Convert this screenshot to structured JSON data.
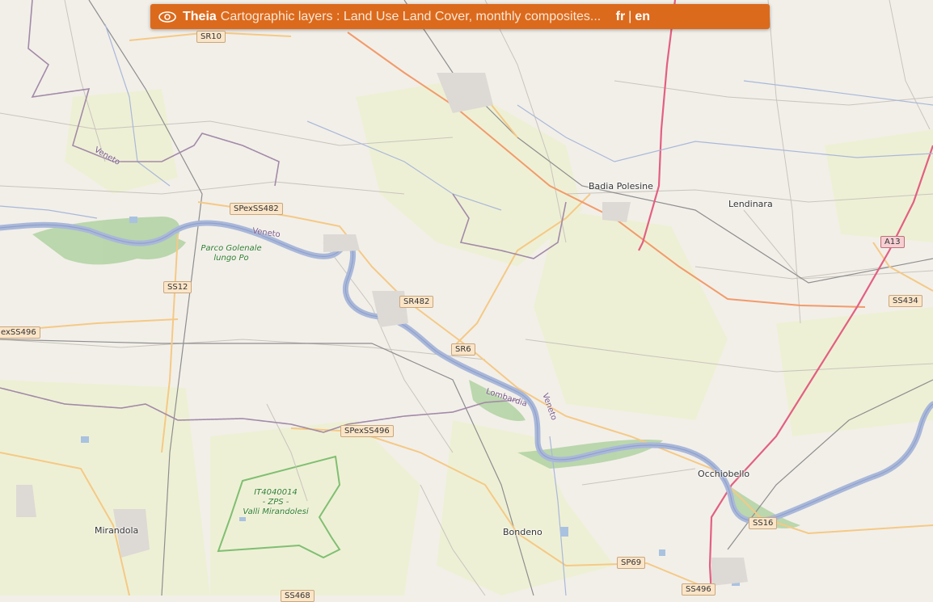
{
  "header": {
    "brand": "Theia",
    "description": "Cartographic layers : Land Use Land Cover, monthly composites...",
    "lang_fr": "fr",
    "lang_sep": "|",
    "lang_en": "en",
    "icon": "eye-icon"
  },
  "places": {
    "badia": "Badia Polesine",
    "lendinara": "Lendinara",
    "occhiobello": "Occhiobello",
    "bondeno": "Bondeno",
    "mirandola": "Mirandola"
  },
  "roads": {
    "sr10": "SR10",
    "spexss482": "SPexSS482",
    "ss12": "SS12",
    "exss496": "exSS496",
    "sr482": "SR482",
    "sr6": "SR6",
    "spexss496": "SPexSS496",
    "a13": "A13",
    "ss434": "SS434",
    "ss16": "SS16",
    "sp69": "SP69",
    "ss496": "SS496",
    "ss468": "SS468"
  },
  "regions": {
    "veneto1": "Veneto",
    "veneto2": "Veneto",
    "lombardia": "Lombardia",
    "veneto3": "Veneto"
  },
  "parks": {
    "po_line1": "Parco Golenale",
    "po_line2": "lungo Po",
    "zps_line1": "IT4040014",
    "zps_line2": "- ZPS -",
    "zps_line3": "Valli Mirandolesi"
  },
  "colors": {
    "topbar": "#dc6a1c",
    "river": "#a9b8d9",
    "motorway": "#e35f81",
    "primary": "#f29b6b",
    "secondary": "#f5c985",
    "boundary": "#a28aa8",
    "farmland": "#eef0d5",
    "wood": "#add19e"
  }
}
